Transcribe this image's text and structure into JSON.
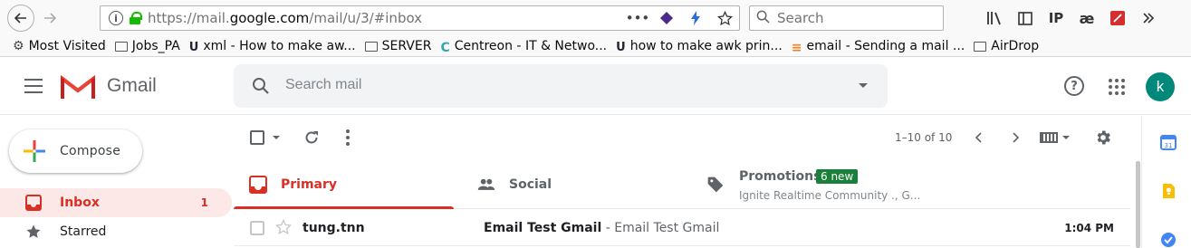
{
  "browser": {
    "url_prefix": "https://mail.",
    "url_domain": "google.com",
    "url_suffix": "/mail/u/3/#inbox",
    "search_placeholder": "Search",
    "url_actions": [
      "more-icon",
      "pocket-icon",
      "lightning-icon",
      "star-icon"
    ],
    "tools": [
      "library-icon",
      "sidebar-icon",
      "ip-icon",
      "ae-icon",
      "pdf-icon",
      "overflow-icon"
    ],
    "tool_glyphs": {
      "ip": "IP",
      "ae": "æ"
    }
  },
  "bookmarks": [
    {
      "label": "Most Visited",
      "icon": "star"
    },
    {
      "label": "Jobs_PA",
      "icon": "folder"
    },
    {
      "label": "xml - How to make aw...",
      "icon": "uf"
    },
    {
      "label": "SERVER",
      "icon": "folder"
    },
    {
      "label": "Centreon - IT & Netwo...",
      "icon": "centreon"
    },
    {
      "label": "how to make awk prin...",
      "icon": "uf"
    },
    {
      "label": "email - Sending a mail ...",
      "icon": "stackoverflow"
    },
    {
      "label": "AirDrop",
      "icon": "folder"
    }
  ],
  "gmail": {
    "brand": "Gmail",
    "search_placeholder": "Search mail",
    "help_glyph": "?",
    "avatar_letter": "k",
    "compose_label": "Compose",
    "nav": [
      {
        "label": "Inbox",
        "count": "1",
        "active": true
      },
      {
        "label": "Starred",
        "count": "",
        "active": false
      }
    ],
    "pager": "1–10 of 10",
    "tabs": [
      {
        "label": "Primary"
      },
      {
        "label": "Social"
      },
      {
        "label": "Promotions",
        "badge": "6 new",
        "subtitle": "Ignite Realtime Community ., G..."
      }
    ],
    "email": {
      "sender": "tung.tnn",
      "subject": "Email Test Gmail",
      "snippet": " - Email Test Gmail",
      "time": "1:04 PM"
    }
  },
  "colors": {
    "accent_red": "#d93025",
    "active_bg": "#fce8e6",
    "badge_green": "#188038",
    "avatar_teal": "#00897b",
    "lock_green": "#12bc00"
  }
}
